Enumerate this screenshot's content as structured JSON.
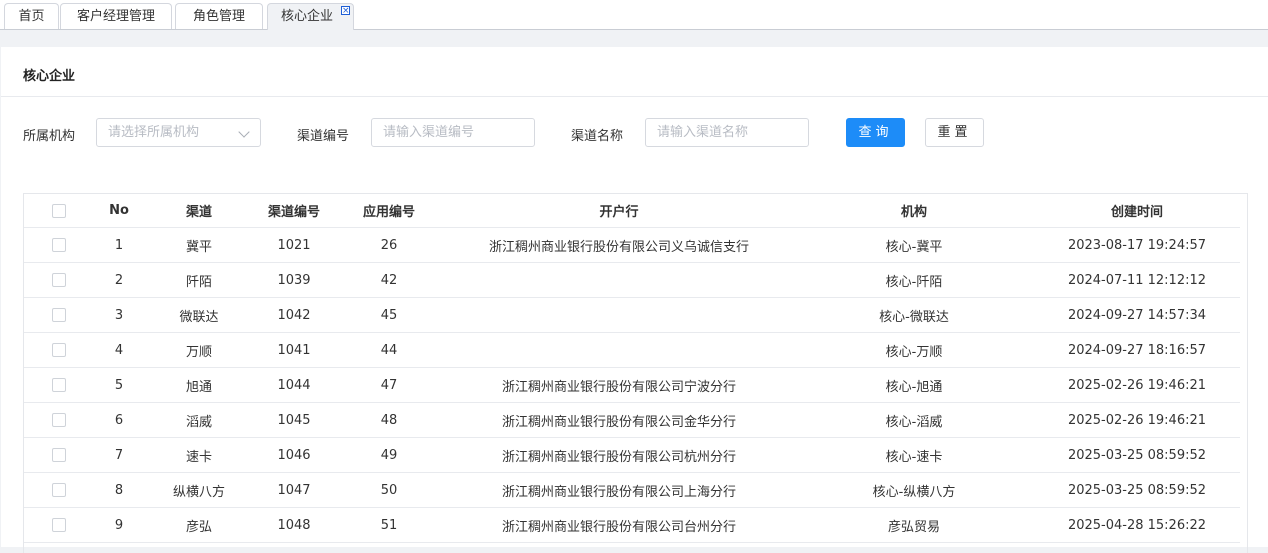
{
  "tabs": [
    {
      "label": "首页"
    },
    {
      "label": "客户经理管理"
    },
    {
      "label": "角色管理"
    },
    {
      "label": "核心企业",
      "close": "×"
    }
  ],
  "card": {
    "title": "核心企业"
  },
  "filters": {
    "org_label": "所属机构",
    "org_placeholder": "请选择所属机构",
    "code_label": "渠道编号",
    "code_placeholder": "请输入渠道编号",
    "name_label": "渠道名称",
    "name_placeholder": "请输入渠道名称",
    "query_label": "查询",
    "reset_label": "重置"
  },
  "table": {
    "headers": [
      "No",
      "渠道",
      "渠道编号",
      "应用编号",
      "开户行",
      "机构",
      "创建时间"
    ],
    "rows": [
      [
        "1",
        "冀平",
        "1021",
        "26",
        "浙江稠州商业银行股份有限公司义乌诚信支行",
        "核心-冀平",
        "2023-08-17 19:24:57"
      ],
      [
        "2",
        "阡陌",
        "1039",
        "42",
        "",
        "核心-阡陌",
        "2024-07-11 12:12:12"
      ],
      [
        "3",
        "微联达",
        "1042",
        "45",
        "",
        "核心-微联达",
        "2024-09-27 14:57:34"
      ],
      [
        "4",
        "万顺",
        "1041",
        "44",
        "",
        "核心-万顺",
        "2024-09-27 18:16:57"
      ],
      [
        "5",
        "旭通",
        "1044",
        "47",
        "浙江稠州商业银行股份有限公司宁波分行",
        "核心-旭通",
        "2025-02-26 19:46:21"
      ],
      [
        "6",
        "滔威",
        "1045",
        "48",
        "浙江稠州商业银行股份有限公司金华分行",
        "核心-滔威",
        "2025-02-26 19:46:21"
      ],
      [
        "7",
        "速卡",
        "1046",
        "49",
        "浙江稠州商业银行股份有限公司杭州分行",
        "核心-速卡",
        "2025-03-25 08:59:52"
      ],
      [
        "8",
        "纵横八方",
        "1047",
        "50",
        "浙江稠州商业银行股份有限公司上海分行",
        "核心-纵横八方",
        "2025-03-25 08:59:52"
      ],
      [
        "9",
        "彦弘",
        "1048",
        "51",
        "浙江稠州商业银行股份有限公司台州分行",
        "彦弘贸易",
        "2025-04-28 15:26:22"
      ]
    ]
  }
}
